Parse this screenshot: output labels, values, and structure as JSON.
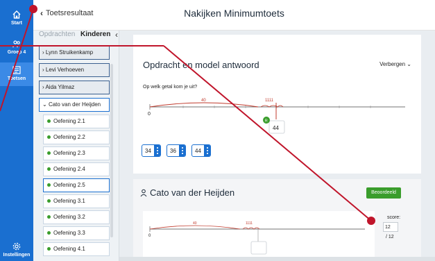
{
  "rail": {
    "items": [
      {
        "label": "Start",
        "icon": "home-icon"
      },
      {
        "label": "Groep 4",
        "icon": "group-icon"
      },
      {
        "label": "Toetsen",
        "icon": "tests-icon"
      },
      {
        "label": "Instellingen",
        "icon": "gear-icon"
      }
    ]
  },
  "header": {
    "back_label": "Toetsresultaat",
    "title": "Nakijken Minimumtoets"
  },
  "sidebar": {
    "tabs": [
      "Opdrachten",
      "Kinderen"
    ],
    "children": [
      "Lynn Struikenkamp",
      "Levi Verhoeven",
      "Aida Yilmaz",
      "Cato van der Heijden"
    ],
    "exercises": [
      "Oefening 2.1",
      "Oefening 2.2",
      "Oefening 2.3",
      "Oefening 2.4",
      "Oefening 2.5",
      "Oefening 3.1",
      "Oefening 3.2",
      "Oefening 3.3",
      "Oefening 4.1"
    ],
    "selected_exercise": "Oefening 2.5"
  },
  "card": {
    "title": "Opdracht en model antwoord",
    "hide_label": "Verbergen",
    "question": "Op welk getal kom je uit?",
    "number_line": {
      "start": "0",
      "jump_label": "40",
      "tally": "1111",
      "answer": "44",
      "marker": "R"
    },
    "choices": [
      "34",
      "36",
      "44"
    ]
  },
  "student": {
    "name": "Cato van der Heijden",
    "status": "Beoordeeld",
    "score_label": "score:",
    "score_value": "12",
    "score_max": "/ 12",
    "number_line": {
      "start": "0",
      "jump_label": "40",
      "tally": "1111"
    }
  },
  "colors": {
    "brand": "#1a6fd0",
    "success": "#3a9d2c",
    "annotation": "#c0152b"
  }
}
